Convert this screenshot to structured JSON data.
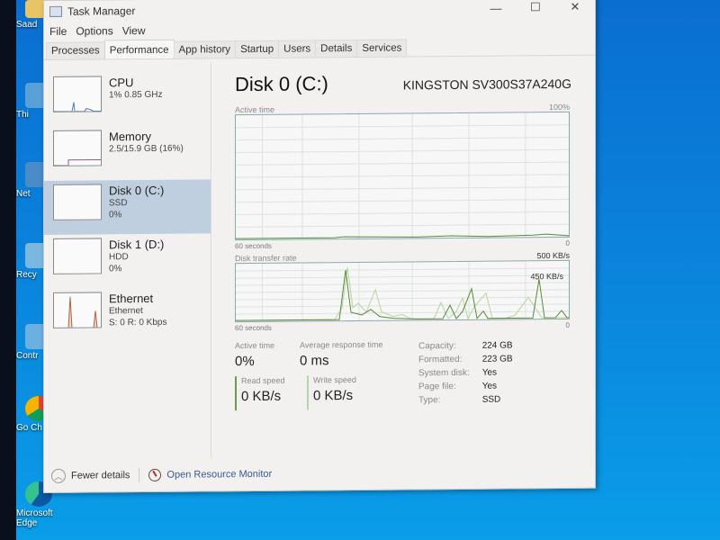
{
  "desktop": {
    "icons": [
      {
        "label": "Saad",
        "icon": "folder-icon"
      },
      {
        "label": "Thi",
        "icon": "this-pc-icon"
      },
      {
        "label": "Net",
        "icon": "network-icon"
      },
      {
        "label": "Recy",
        "icon": "recycle-bin-icon"
      },
      {
        "label": "Contr",
        "icon": "control-panel-icon"
      },
      {
        "label": "Go Ch",
        "icon": "chrome-icon"
      },
      {
        "label": "Microsoft Edge",
        "icon": "edge-icon"
      }
    ]
  },
  "window": {
    "title": "Task Manager",
    "controls": {
      "minimize": "—",
      "maximize": "☐",
      "close": "✕"
    },
    "menu": [
      "File",
      "Options",
      "View"
    ],
    "tabs": [
      "Processes",
      "Performance",
      "App history",
      "Startup",
      "Users",
      "Details",
      "Services"
    ],
    "active_tab": "Performance"
  },
  "sidebar": {
    "items": [
      {
        "name": "CPU",
        "line1": "1% 0.85 GHz",
        "line2": ""
      },
      {
        "name": "Memory",
        "line1": "2.5/15.9 GB (16%)",
        "line2": ""
      },
      {
        "name": "Disk 0 (C:)",
        "line1": "SSD",
        "line2": "0%"
      },
      {
        "name": "Disk 1 (D:)",
        "line1": "HDD",
        "line2": "0%"
      },
      {
        "name": "Ethernet",
        "line1": "Ethernet",
        "line2": "S: 0 R: 0 Kbps"
      }
    ],
    "active": "Disk 0 (C:)"
  },
  "main": {
    "title": "Disk 0 (C:)",
    "model": "KINGSTON SV300S37A240G",
    "active_graph": {
      "label": "Active time",
      "max": "100%",
      "time": "60 seconds",
      "min": "0"
    },
    "transfer_graph": {
      "label": "Disk transfer rate",
      "max": "500 KB/s",
      "marker": "450 KB/s",
      "time": "60 seconds",
      "min": "0"
    },
    "stats": {
      "active_time_label": "Active time",
      "active_time_value": "0%",
      "avg_response_label": "Average response time",
      "avg_response_value": "0 ms",
      "read_label": "Read speed",
      "read_value": "0 KB/s",
      "write_label": "Write speed",
      "write_value": "0 KB/s"
    },
    "properties": [
      {
        "key": "Capacity:",
        "value": "224 GB"
      },
      {
        "key": "Formatted:",
        "value": "223 GB"
      },
      {
        "key": "System disk:",
        "value": "Yes"
      },
      {
        "key": "Page file:",
        "value": "Yes"
      },
      {
        "key": "Type:",
        "value": "SSD"
      }
    ]
  },
  "footer": {
    "fewer_details": "Fewer details",
    "open_resource_monitor": "Open Resource Monitor"
  },
  "colors": {
    "disk_line": "#5a8a3a",
    "disk_line_light": "#b8d4a0",
    "ethernet": "#b4643c",
    "selected_bg": "#bfcfdf"
  }
}
